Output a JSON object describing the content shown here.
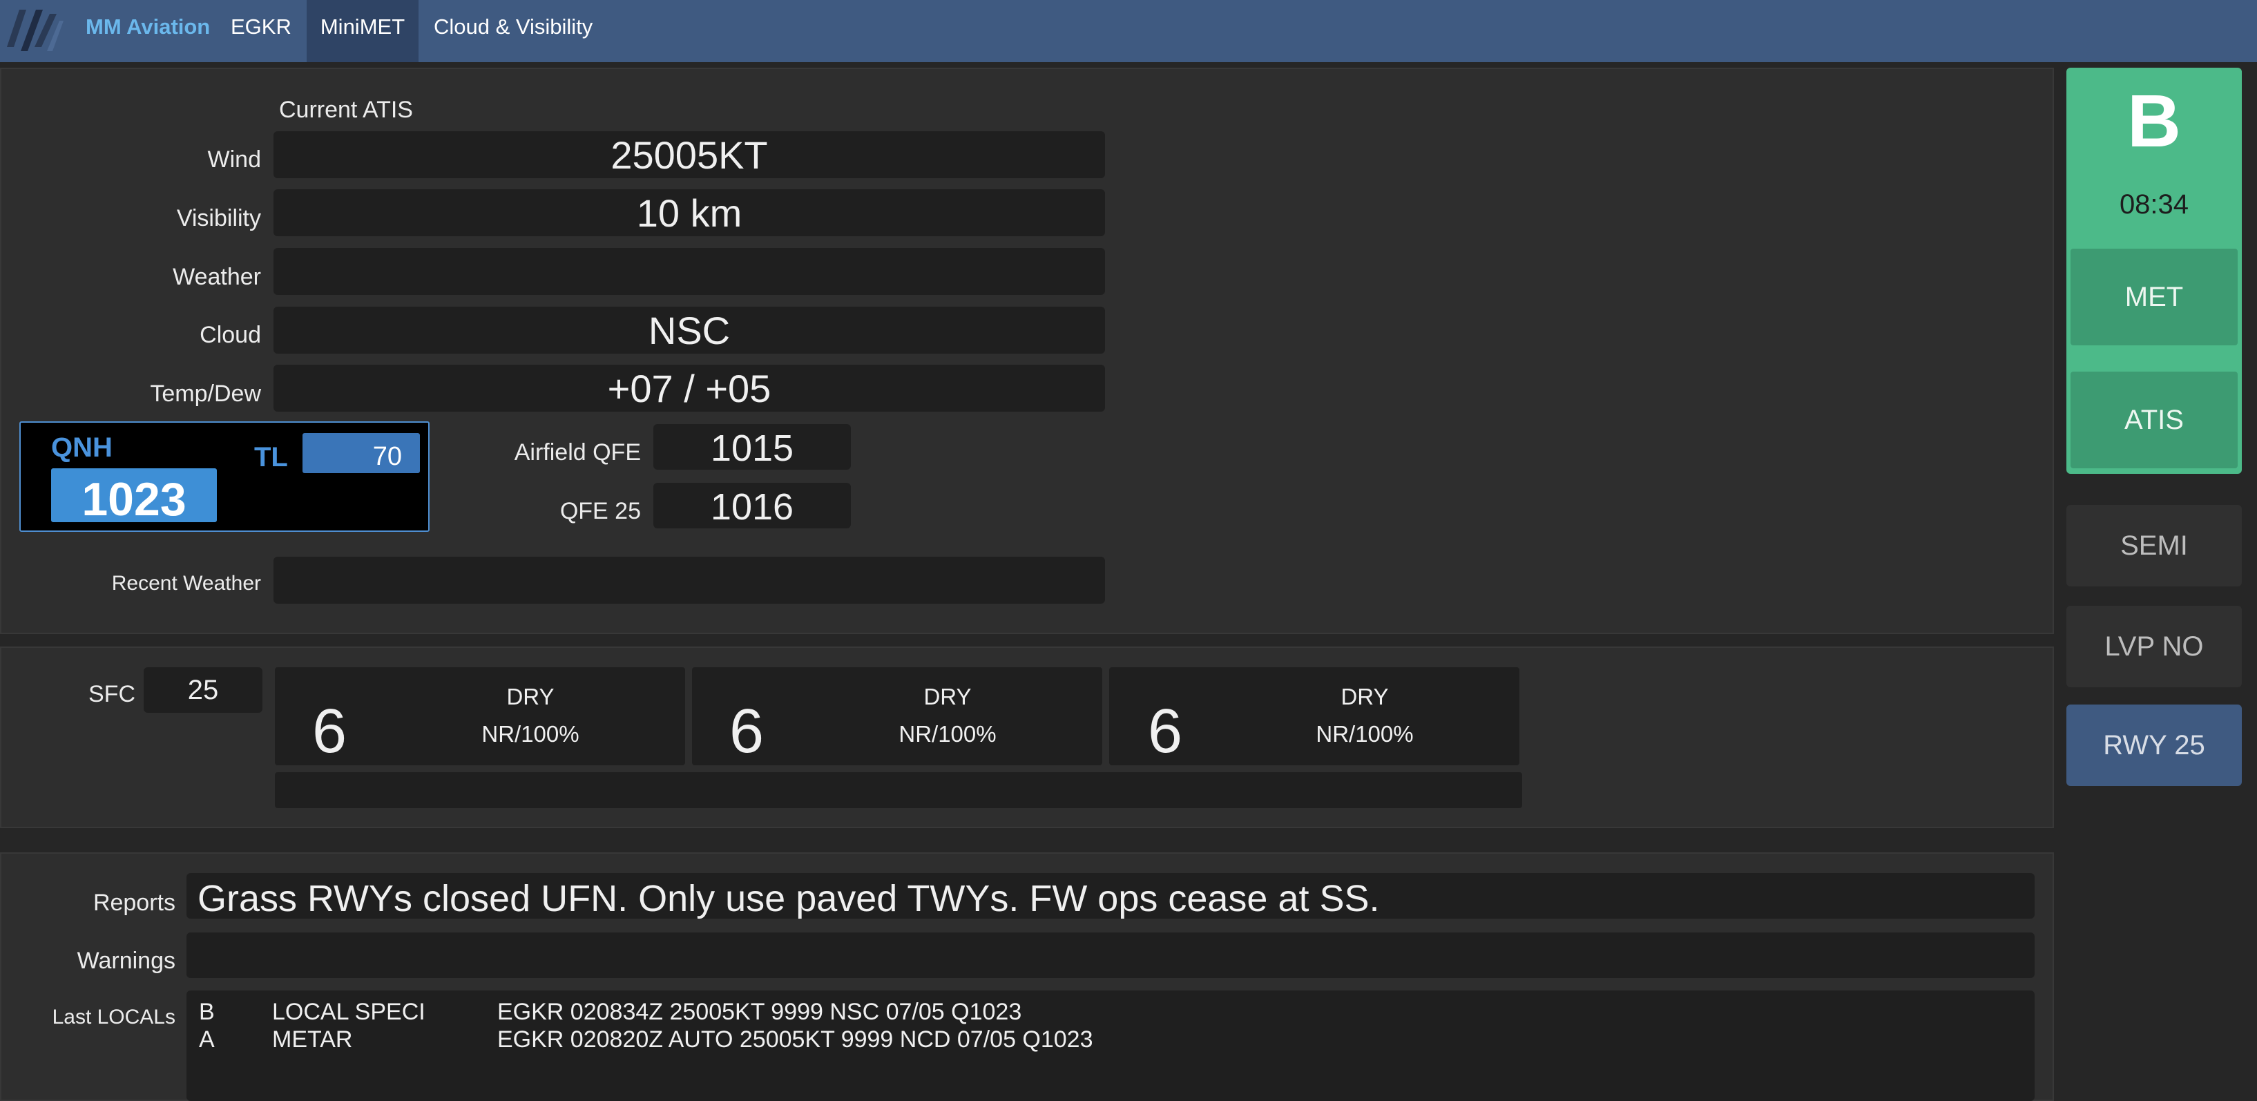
{
  "nav": {
    "brand": "MM Aviation",
    "items": [
      {
        "label": "EGKR"
      },
      {
        "label": "MiniMET"
      },
      {
        "label": "Cloud & Visibility"
      }
    ]
  },
  "atis": {
    "heading": "Current ATIS",
    "wind": {
      "label": "Wind",
      "value": "25005KT"
    },
    "visibility": {
      "label": "Visibility",
      "value": "10 km"
    },
    "weather": {
      "label": "Weather",
      "value": ""
    },
    "cloud": {
      "label": "Cloud",
      "value": "NSC"
    },
    "temp_dew": {
      "label": "Temp/Dew",
      "value": "+07 / +05"
    },
    "qnh": {
      "label": "QNH",
      "value": "1023"
    },
    "tl": {
      "label": "TL",
      "value": "70"
    },
    "airfield_qfe": {
      "label": "Airfield QFE",
      "value": "1015"
    },
    "qfe_25": {
      "label": "QFE 25",
      "value": "1016"
    },
    "recent_weather": {
      "label": "Recent Weather",
      "value": ""
    }
  },
  "runway": {
    "sfc_label": "SFC",
    "sfc_value": "25",
    "segments": [
      {
        "number": "6",
        "state": "DRY",
        "condition": "NR/100%"
      },
      {
        "number": "6",
        "state": "DRY",
        "condition": "NR/100%"
      },
      {
        "number": "6",
        "state": "DRY",
        "condition": "NR/100%"
      }
    ],
    "remarks": ""
  },
  "reports": {
    "reports_label": "Reports",
    "reports_text": "Grass RWYs closed UFN. Only use paved TWYs. FW ops cease at SS.",
    "warnings_label": "Warnings",
    "warnings_text": "",
    "locals_label": "Last LOCALs",
    "locals": [
      {
        "id": "B",
        "type": "LOCAL SPECI",
        "report": "EGKR 020834Z 25005KT 9999 NSC 07/05 Q1023"
      },
      {
        "id": "A",
        "type": "METAR",
        "report": "EGKR 020820Z AUTO 25005KT 9999 NCD 07/05 Q1023"
      }
    ]
  },
  "status": {
    "atis_letter": "B",
    "time": "08:34",
    "met_label": "MET",
    "atis_label": "ATIS",
    "semi_label": "SEMI",
    "lvp_label": "LVP NO",
    "rwy_label": "RWY 25"
  },
  "colors": {
    "navbar": "#3f5a81",
    "brand": "#6bb8ec",
    "status_green": "#4cba89",
    "qnh_blue": "#3e8fd6"
  }
}
